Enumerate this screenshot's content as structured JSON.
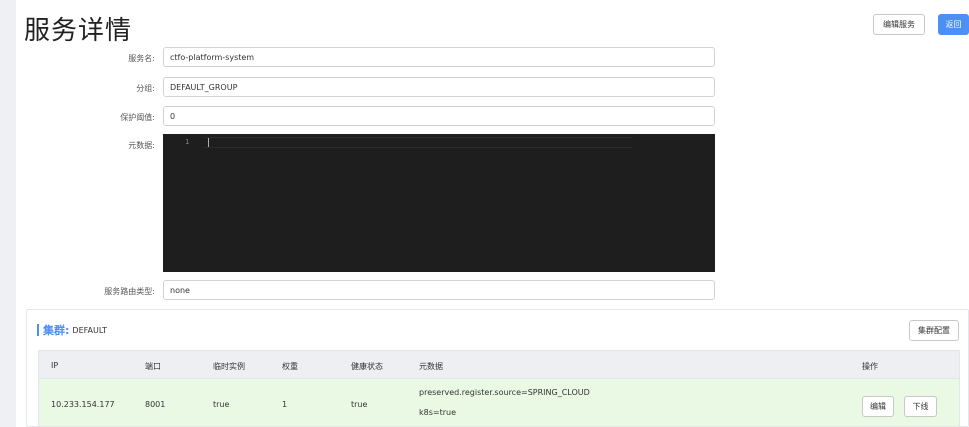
{
  "header": {
    "title": "服务详情",
    "edit_button": "编辑服务",
    "back_button": "返回"
  },
  "form": {
    "service_name_label": "服务名:",
    "service_name_value": "ctfo-platform-system",
    "group_label": "分组:",
    "group_value": "DEFAULT_GROUP",
    "threshold_label": "保护阈值:",
    "threshold_value": "0",
    "metadata_label": "元数据:",
    "metadata_line_number": "1",
    "selector_label": "服务路由类型:",
    "selector_value": "none"
  },
  "cluster": {
    "title": "集群:",
    "name": "DEFAULT",
    "config_button": "集群配置",
    "columns": [
      "IP",
      "端口",
      "临时实例",
      "权重",
      "健康状态",
      "元数据",
      "操作"
    ],
    "rows": [
      {
        "ip": "10.233.154.177",
        "port": "8001",
        "ephemeral": "true",
        "weight": "1",
        "healthy": "true",
        "metadata_line1": "preserved.register.source=SPRING_CLOUD",
        "metadata_line2": "k8s=true",
        "edit_label": "编辑",
        "offline_label": "下线"
      }
    ]
  }
}
